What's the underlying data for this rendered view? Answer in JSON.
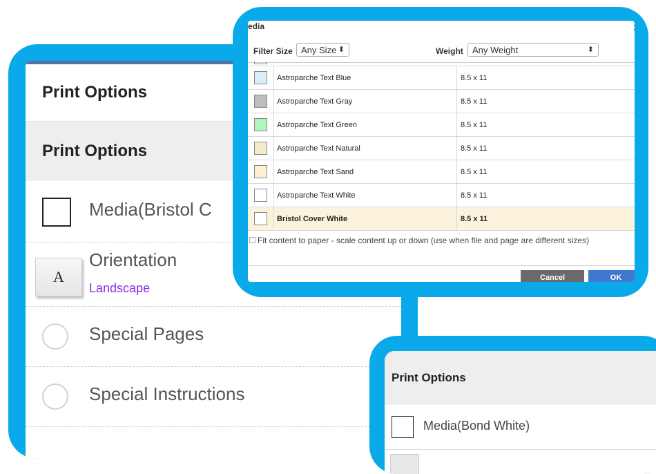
{
  "left_panel": {
    "title": "Print Options",
    "section_title": "Print Options",
    "rows": [
      {
        "label": "Media(Bristol C"
      },
      {
        "label": "Orientation",
        "icon_letter": "A",
        "value": "Landscape"
      },
      {
        "label": "Special Pages"
      },
      {
        "label": "Special Instructions"
      }
    ]
  },
  "dialog": {
    "title": "edia",
    "close_symbol": "×",
    "filter_size_label": "Filter Size",
    "size_select": {
      "value": "Any Size",
      "arrow": "⬍"
    },
    "weight_label": "Weight",
    "weight_select": {
      "value": "Any Weight",
      "arrow": "⬍"
    },
    "media_rows": [
      {
        "name": "Astroparche Text Blue",
        "size": "8.5 x 11",
        "color": "#dbeefb"
      },
      {
        "name": "Astroparche Text Gray",
        "size": "8.5 x 11",
        "color": "#bdbdbd"
      },
      {
        "name": "Astroparche Text Green",
        "size": "8.5 x 11",
        "color": "#b3f5bf"
      },
      {
        "name": "Astroparche Text Natural",
        "size": "8.5 x 11",
        "color": "#f3ecca"
      },
      {
        "name": "Astroparche Text Sand",
        "size": "8.5 x 11",
        "color": "#fdefd4"
      },
      {
        "name": "Astroparche Text White",
        "size": "8.5 x 11",
        "color": "#ffffff"
      },
      {
        "name": "Bristol Cover White",
        "size": "8.5 x 11",
        "color": "#ffffff",
        "selected": true
      }
    ],
    "fit_text": "Fit content to paper - scale content up or down (use when file and page are different sizes)",
    "cancel_label": "Cancel",
    "ok_label": "OK"
  },
  "bottom_panel": {
    "title": "Print Options",
    "media_label": "Media(Bond White)"
  }
}
